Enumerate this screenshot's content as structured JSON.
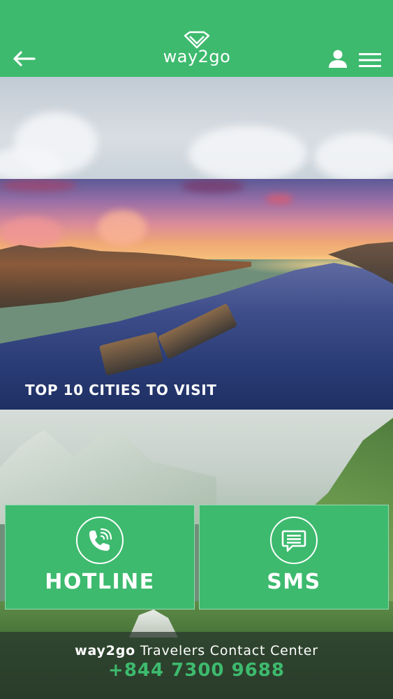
{
  "header": {
    "logo_text": "way2go",
    "background_color": "#3dba6e"
  },
  "feature": {
    "title": "TOP 10 CITIES TO VISIT"
  },
  "actions": {
    "hotline_label": "HOTLINE",
    "sms_label": "SMS"
  },
  "footer": {
    "brand": "way2go",
    "tagline": "Travelers Contact Center",
    "phone": "+844 7300 9688"
  },
  "icons": {
    "back": "arrow-left-icon",
    "user": "user-icon",
    "menu": "hamburger-menu-icon",
    "hotline": "phone-icon",
    "sms": "message-icon"
  },
  "colors": {
    "accent": "#3dba6e",
    "text_on_accent": "#ffffff"
  }
}
